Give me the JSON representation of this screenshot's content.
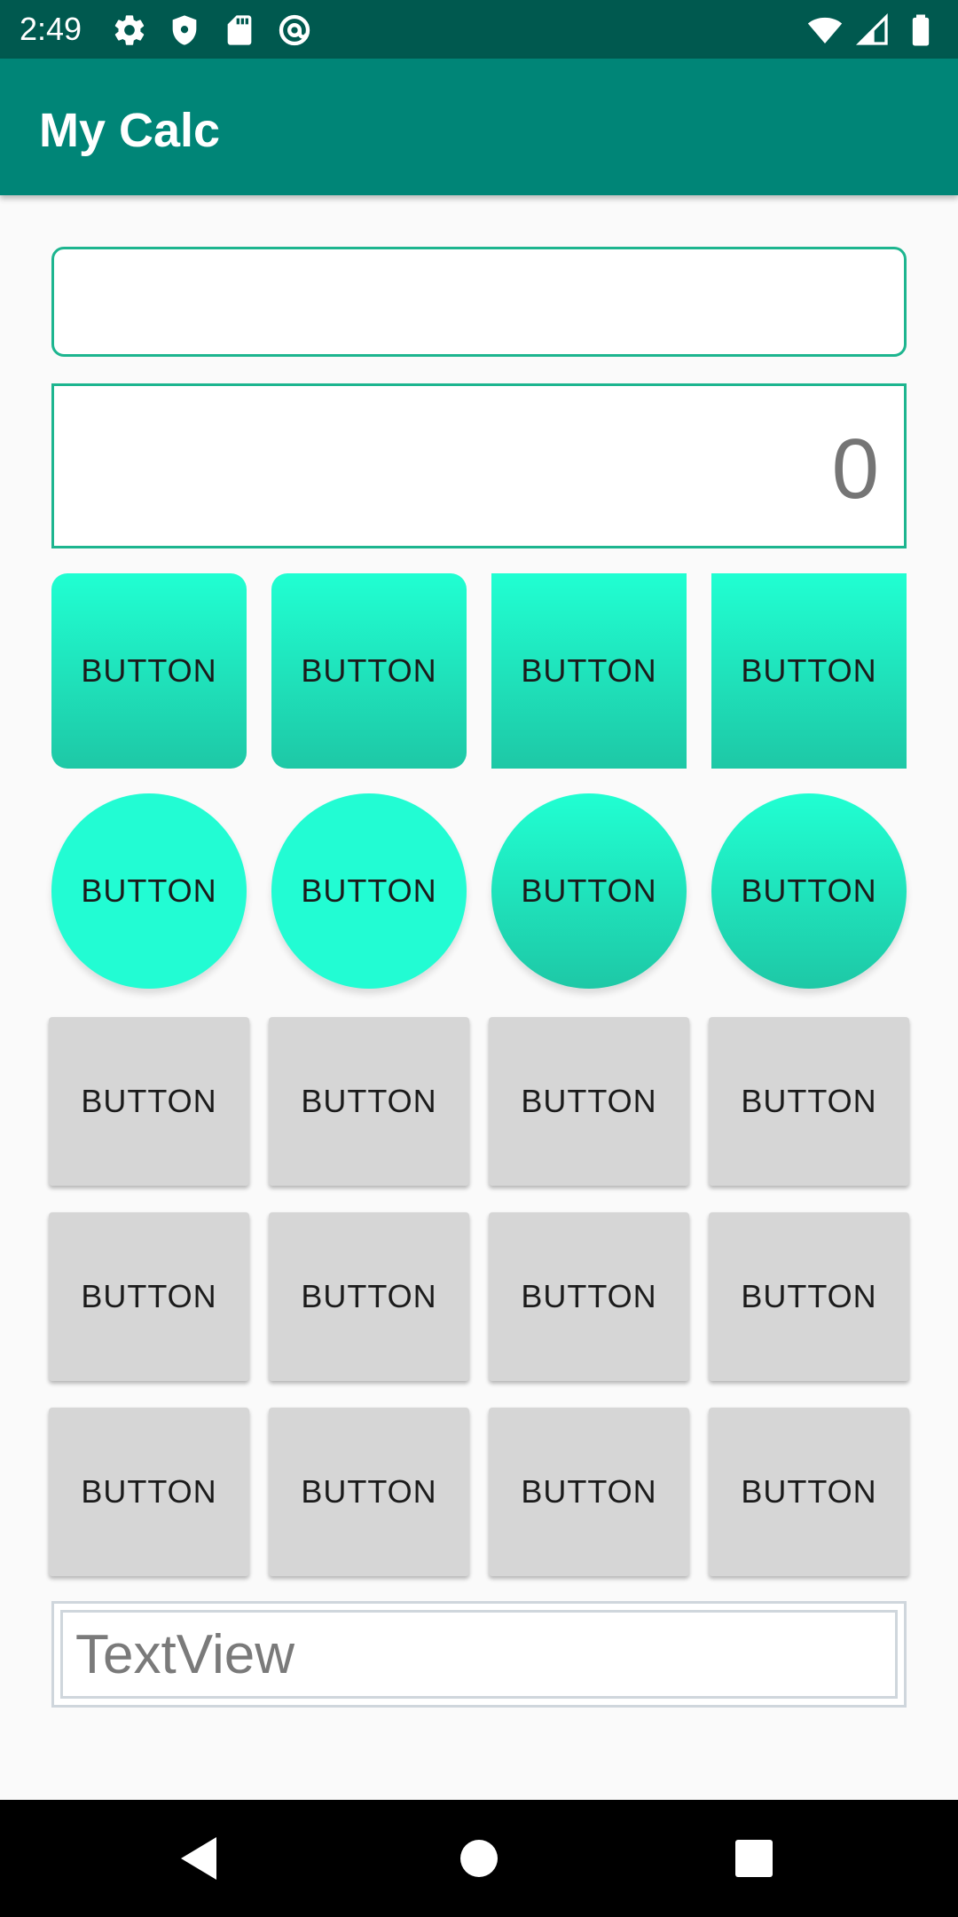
{
  "status_bar": {
    "time": "2:49",
    "left_icons": [
      "settings-icon",
      "shield-icon",
      "sd-card-icon",
      "at-sign-icon"
    ],
    "right_icons": [
      "wifi-icon",
      "cell-signal-icon",
      "battery-icon"
    ]
  },
  "app_bar": {
    "title": "My Calc"
  },
  "input_field": {
    "value": "",
    "placeholder": ""
  },
  "result_field": {
    "value": "0"
  },
  "rows": {
    "square": [
      "BUTTON",
      "BUTTON",
      "BUTTON",
      "BUTTON"
    ],
    "circle": [
      "BUTTON",
      "BUTTON",
      "BUTTON",
      "BUTTON"
    ],
    "grid1": [
      "BUTTON",
      "BUTTON",
      "BUTTON",
      "BUTTON"
    ],
    "grid2": [
      "BUTTON",
      "BUTTON",
      "BUTTON",
      "BUTTON"
    ],
    "grid3": [
      "BUTTON",
      "BUTTON",
      "BUTTON",
      "BUTTON"
    ]
  },
  "textview": {
    "text": "TextView"
  },
  "nav_bar": {
    "icons": [
      "back-icon",
      "home-icon",
      "recents-icon"
    ]
  },
  "colors": {
    "status_bar": "#00594f",
    "app_bar": "#008577",
    "accent_border": "#1db58f",
    "mint_top": "#20ffd2",
    "mint_bottom": "#1ec8a6",
    "gray_button": "#d6d6d6"
  }
}
